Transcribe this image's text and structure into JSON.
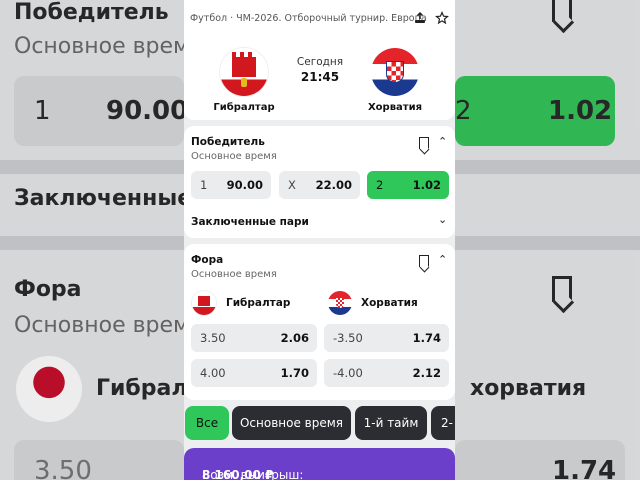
{
  "match": {
    "breadcrumb": "Футбол · ЧМ-2026. Отборочный турнир. Европа",
    "day": "Сегодня",
    "time": "21:45",
    "home": "Гибралтар",
    "away": "Хорватия"
  },
  "winner": {
    "title": "Победитель",
    "subtitle": "Основное время",
    "odds": [
      {
        "label": "1",
        "value": "90.00",
        "selected": false
      },
      {
        "label": "X",
        "value": "22.00",
        "selected": false
      },
      {
        "label": "2",
        "value": "1.02",
        "selected": true
      }
    ],
    "parlays_label": "Заключенные пари"
  },
  "fora": {
    "title": "Фора",
    "subtitle": "Основное время",
    "home": "Гибралтар",
    "away": "Хорватия",
    "rows": [
      {
        "home_line": "3.50",
        "home_odd": "2.06",
        "away_line": "-3.50",
        "away_odd": "1.74"
      },
      {
        "home_line": "4.00",
        "home_odd": "1.70",
        "away_line": "-4.00",
        "away_odd": "2.12"
      }
    ]
  },
  "filters": [
    "Все",
    "Основное время",
    "1-й тайм",
    "2-"
  ],
  "win_bar": {
    "label": "Возм. выигрыш:",
    "amount": "8 160,00 ₽"
  },
  "background": {
    "title1": "Победитель",
    "sub1": "Основное время",
    "odd1_label": "1",
    "odd1_value": "90.00",
    "odd2_label": "2",
    "odd2_value": "1.02",
    "title2": "Заключенные пари",
    "title3": "Фора",
    "sub3": "Основное время",
    "team1": "Гибралт",
    "team2": "хорватия",
    "line1": "3.50",
    "odd_right": "1.74"
  },
  "colors": {
    "accent_green": "#2fc65a",
    "bar_purple": "#6b3fc9",
    "chip_dark": "#2b2d33"
  }
}
